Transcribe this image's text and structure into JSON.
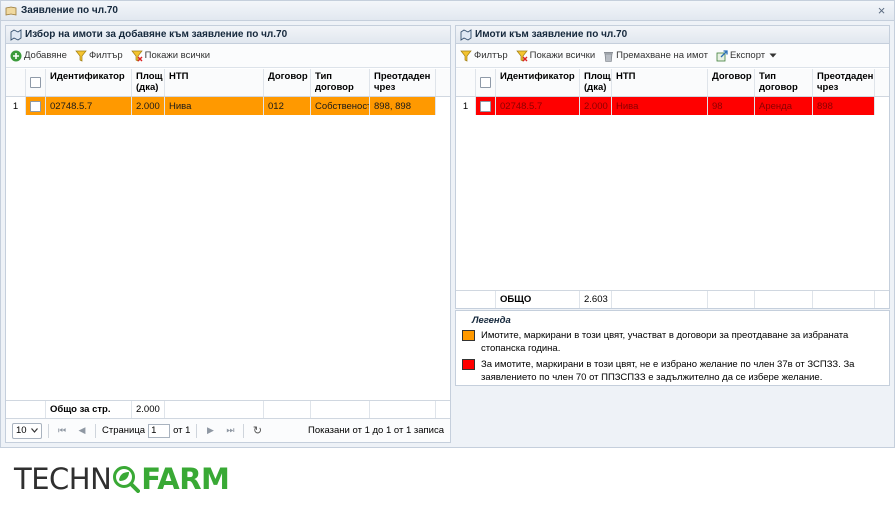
{
  "window": {
    "title": "Заявление по чл.70"
  },
  "left_panel": {
    "title": "Избор на имоти за добавяне към заявление по чл.70",
    "toolbar": {
      "add": "Добавяне",
      "filter": "Филтър",
      "show_all": "Покажи всички"
    },
    "columns": [
      "Идентификатор",
      "Площ (дка)",
      "НТП",
      "Договор",
      "Тип договор",
      "Преотдаден чрез"
    ],
    "rows": [
      {
        "num": "1",
        "id": "02748.5.7",
        "area": "2.000",
        "ntp": "Нива",
        "contract": "012",
        "type": "Собственост",
        "via": "898, 898",
        "color": "#ff9900"
      }
    ],
    "footer": {
      "label": "Общо за стр.",
      "area": "2.000"
    },
    "pager": {
      "page_size": "10",
      "page_label": "Страница",
      "page": "1",
      "of_label": "от 1",
      "info": "Показани от 1 до 1 от 1 записа"
    }
  },
  "right_panel": {
    "title": "Имоти към заявление по чл.70",
    "toolbar": {
      "filter": "Филтър",
      "show_all": "Покажи всички",
      "remove": "Премахване на имот",
      "export": "Експорт"
    },
    "columns": [
      "Идентификатор",
      "Площ (дка)",
      "НТП",
      "Договор",
      "Тип договор",
      "Преотдаден чрез"
    ],
    "rows": [
      {
        "num": "1",
        "id": "02748.5.7",
        "area": "2.000",
        "ntp": "Нива",
        "contract": "98",
        "type": "Аренда",
        "via": "898",
        "color": "#ff0000"
      }
    ],
    "footer": {
      "label": "ОБЩО",
      "area": "2.603"
    }
  },
  "legend": {
    "title": "Легенда",
    "items": [
      {
        "color": "#ff9900",
        "text": "Имотите, маркирани в този цвят, участват в договори за преотдаване за избраната стопанска година."
      },
      {
        "color": "#ff0000",
        "text": "За имотите, маркирани в този цвят, не е избрано желание по член 37в от ЗСПЗЗ. За заявлението по член 70 от ППЗСПЗЗ е задължително да се избере желание."
      }
    ]
  },
  "logo": {
    "part1": "TECHN",
    "part2": "FARM"
  }
}
